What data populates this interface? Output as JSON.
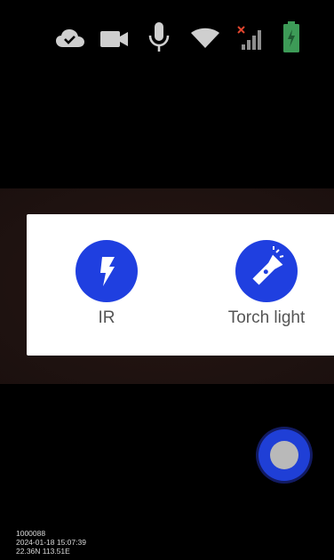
{
  "status_bar": {
    "icons": [
      "cloud-check-icon",
      "video-camera-icon",
      "microphone-icon",
      "wifi-icon",
      "signal-no-service-icon",
      "battery-charging-icon"
    ],
    "icon_color": "#cfcfcf",
    "battery_color": "#3d9b57",
    "no_signal_color": "#e0452e"
  },
  "controls": {
    "ir": {
      "label": "IR",
      "icon": "lightning-bolt-icon"
    },
    "torch": {
      "label": "Torch light",
      "icon": "flashlight-icon"
    },
    "accent": "#1f3fe0"
  },
  "overlay": {
    "device_id": "1000088",
    "datetime": "2024-01-18 15:07:39",
    "location": "22.36N 113.51E"
  }
}
